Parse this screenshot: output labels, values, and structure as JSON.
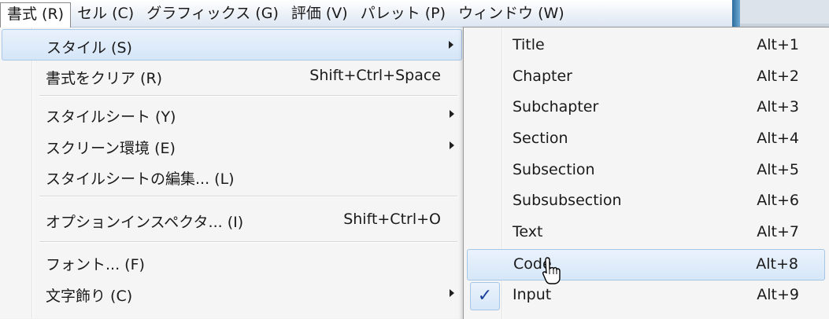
{
  "menubar": {
    "items": [
      {
        "label": "書式 (R)"
      },
      {
        "label": "セル (C)"
      },
      {
        "label": "グラフィックス (G)"
      },
      {
        "label": "評価 (V)"
      },
      {
        "label": "パレット (P)"
      },
      {
        "label": "ウィンドウ (W)"
      }
    ]
  },
  "format_menu": {
    "items": [
      {
        "label": "スタイル (S)",
        "shortcut": "",
        "submenu": true
      },
      {
        "label": "書式をクリア (R)",
        "shortcut": "Shift+Ctrl+Space"
      },
      {
        "label": "スタイルシート (Y)",
        "shortcut": "",
        "submenu": true
      },
      {
        "label": "スクリーン環境 (E)",
        "shortcut": "",
        "submenu": true
      },
      {
        "label": "スタイルシートの編集... (L)",
        "shortcut": ""
      },
      {
        "label": "オプションインスペクタ... (I)",
        "shortcut": "Shift+Ctrl+O"
      },
      {
        "label": "フォント... (F)",
        "shortcut": ""
      },
      {
        "label": "文字飾り (C)",
        "shortcut": "",
        "submenu": true
      }
    ]
  },
  "style_submenu": {
    "items": [
      {
        "label": "Title",
        "shortcut": "Alt+1"
      },
      {
        "label": "Chapter",
        "shortcut": "Alt+2"
      },
      {
        "label": "Subchapter",
        "shortcut": "Alt+3"
      },
      {
        "label": "Section",
        "shortcut": "Alt+4"
      },
      {
        "label": "Subsection",
        "shortcut": "Alt+5"
      },
      {
        "label": "Subsubsection",
        "shortcut": "Alt+6"
      },
      {
        "label": "Text",
        "shortcut": "Alt+7"
      },
      {
        "label": "Code",
        "shortcut": "Alt+8"
      },
      {
        "label": "Input",
        "shortcut": "Alt+9",
        "checked": true
      }
    ],
    "check_glyph": "✓"
  },
  "colors": {
    "highlight": "#d5e6f8",
    "highlight_border": "#a8c8ea",
    "check": "#1c3f9a"
  }
}
